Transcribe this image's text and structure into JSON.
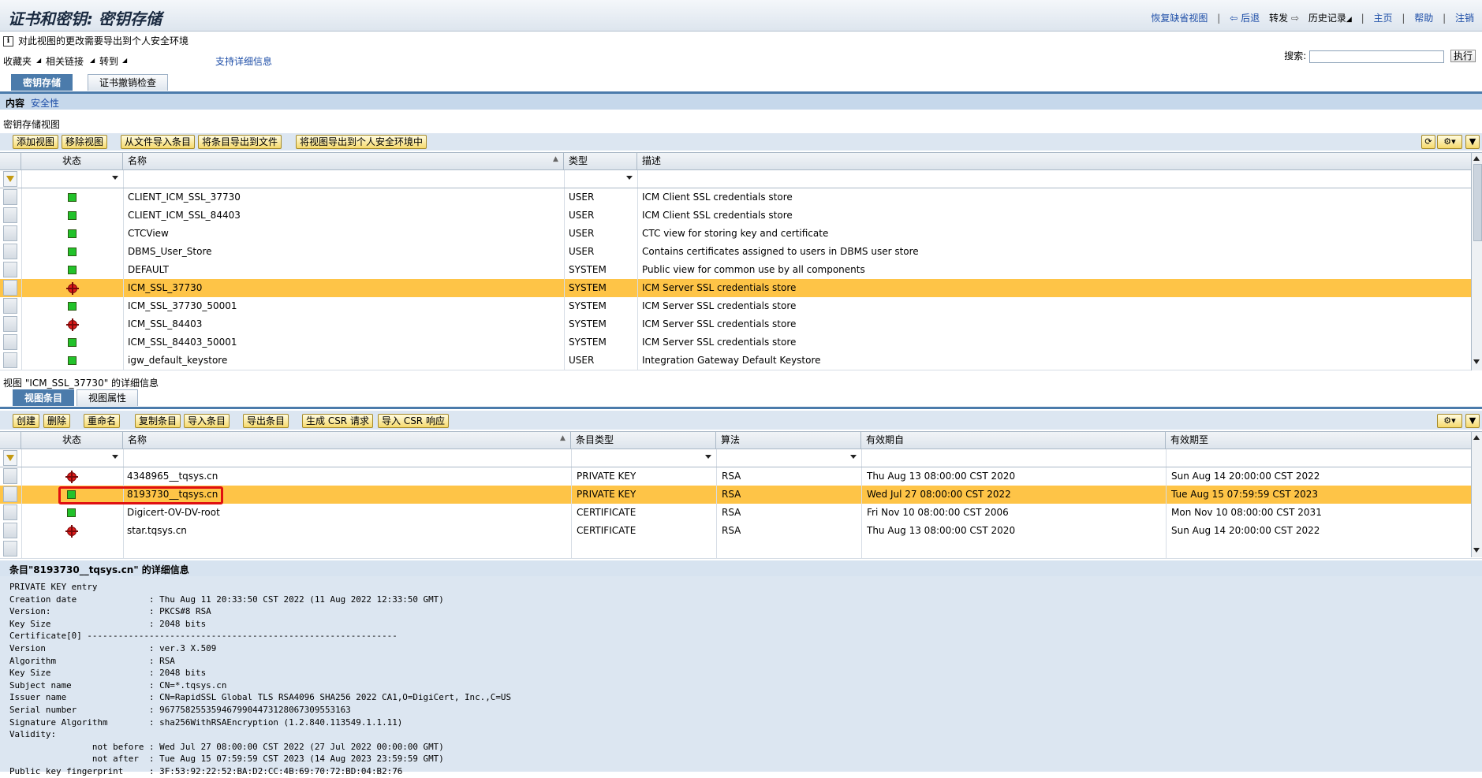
{
  "header": {
    "title": "证书和密钥: 密钥存储",
    "links": [
      "恢复缺省视图",
      "后退",
      "转发",
      "历史记录",
      "主页",
      "帮助",
      "注销"
    ]
  },
  "info_message": "对此视图的更改需要导出到个人安全环境",
  "menu": {
    "favorites": "收藏夹",
    "related_links": "相关链接",
    "goto": "转到",
    "support": "支持详细信息"
  },
  "search": {
    "label": "搜索:",
    "value": "",
    "button": "执行"
  },
  "main_tabs": [
    "密钥存储",
    "证书撤销检查"
  ],
  "subnav": {
    "content": "内容",
    "security": "安全性"
  },
  "keystore_section": {
    "title": "密钥存储视图",
    "buttons": [
      "添加视图",
      "移除视图",
      "从文件导入条目",
      "将条目导出到文件",
      "将视图导出到个人安全环境中"
    ],
    "columns": [
      "状态",
      "名称",
      "类型",
      "描述"
    ],
    "rows": [
      {
        "status": "ok",
        "name": "CLIENT_ICM_SSL_37730",
        "type": "USER",
        "desc": "ICM Client SSL credentials store"
      },
      {
        "status": "ok",
        "name": "CLIENT_ICM_SSL_84403",
        "type": "USER",
        "desc": "ICM Client SSL credentials store"
      },
      {
        "status": "ok",
        "name": "CTCView",
        "type": "USER",
        "desc": "CTC view for storing key and certificate"
      },
      {
        "status": "ok",
        "name": "DBMS_User_Store",
        "type": "USER",
        "desc": "Contains certificates assigned to users in DBMS user store"
      },
      {
        "status": "ok",
        "name": "DEFAULT",
        "type": "SYSTEM",
        "desc": "Public view for common use by all components"
      },
      {
        "status": "error",
        "name": "ICM_SSL_37730",
        "type": "SYSTEM",
        "desc": "ICM Server SSL credentials store",
        "selected": true
      },
      {
        "status": "ok",
        "name": "ICM_SSL_37730_50001",
        "type": "SYSTEM",
        "desc": "ICM Server SSL credentials store"
      },
      {
        "status": "error",
        "name": "ICM_SSL_84403",
        "type": "SYSTEM",
        "desc": "ICM Server SSL credentials store"
      },
      {
        "status": "ok",
        "name": "ICM_SSL_84403_50001",
        "type": "SYSTEM",
        "desc": "ICM Server SSL credentials store"
      },
      {
        "status": "ok",
        "name": "igw_default_keystore",
        "type": "USER",
        "desc": "Integration Gateway Default Keystore"
      }
    ]
  },
  "view_detail": {
    "title": "视图 \"ICM_SSL_37730\" 的详细信息",
    "tabs": [
      "视图条目",
      "视图属性"
    ],
    "buttons": [
      "创建",
      "删除",
      "重命名",
      "复制条目",
      "导入条目",
      "导出条目",
      "生成 CSR 请求",
      "导入 CSR 响应"
    ],
    "columns": [
      "状态",
      "名称",
      "条目类型",
      "算法",
      "有效期自",
      "有效期至"
    ],
    "rows": [
      {
        "status": "error",
        "name": "4348965__tqsys.cn",
        "type": "PRIVATE KEY",
        "alg": "RSA",
        "from": "Thu Aug 13 08:00:00 CST 2020",
        "to": "Sun Aug 14 20:00:00 CST 2022"
      },
      {
        "status": "ok",
        "name": "8193730__tqsys.cn",
        "type": "PRIVATE KEY",
        "alg": "RSA",
        "from": "Wed Jul 27 08:00:00 CST 2022",
        "to": "Tue Aug 15 07:59:59 CST 2023",
        "selected": true
      },
      {
        "status": "ok",
        "name": "Digicert-OV-DV-root",
        "type": "CERTIFICATE",
        "alg": "RSA",
        "from": "Fri Nov 10 08:00:00 CST 2006",
        "to": "Mon Nov 10 08:00:00 CST 2031"
      },
      {
        "status": "error",
        "name": "star.tqsys.cn",
        "type": "CERTIFICATE",
        "alg": "RSA",
        "from": "Thu Aug 13 08:00:00 CST 2020",
        "to": "Sun Aug 14 20:00:00 CST 2022"
      }
    ]
  },
  "entry_detail": {
    "title": "条目\"8193730__tqsys.cn\" 的详细信息",
    "text": "PRIVATE KEY entry\nCreation date              : Thu Aug 11 20:33:50 CST 2022 (11 Aug 2022 12:33:50 GMT)\nVersion:                   : PKCS#8 RSA\nKey Size                   : 2048 bits\nCertificate[0] ------------------------------------------------------------\nVersion                    : ver.3 X.509\nAlgorithm                  : RSA\nKey Size                   : 2048 bits\nSubject name               : CN=*.tqsys.cn\nIssuer name                : CN=RapidSSL Global TLS RSA4096 SHA256 2022 CA1,O=DigiCert, Inc.,C=US\nSerial number              : 9677582553594679904473128067309553163\nSignature Algorithm        : sha256WithRSAEncryption (1.2.840.113549.1.1.11)\nValidity:\n                not before : Wed Jul 27 08:00:00 CST 2022 (27 Jul 2022 00:00:00 GMT)\n                not after  : Tue Aug 15 07:59:59 CST 2023 (14 Aug 2023 23:59:59 GMT)\nPublic key fingerprint     : 3F:53:92:22:52:BA:D2:CC:4B:69:70:72:BD:04:B2:76"
  }
}
